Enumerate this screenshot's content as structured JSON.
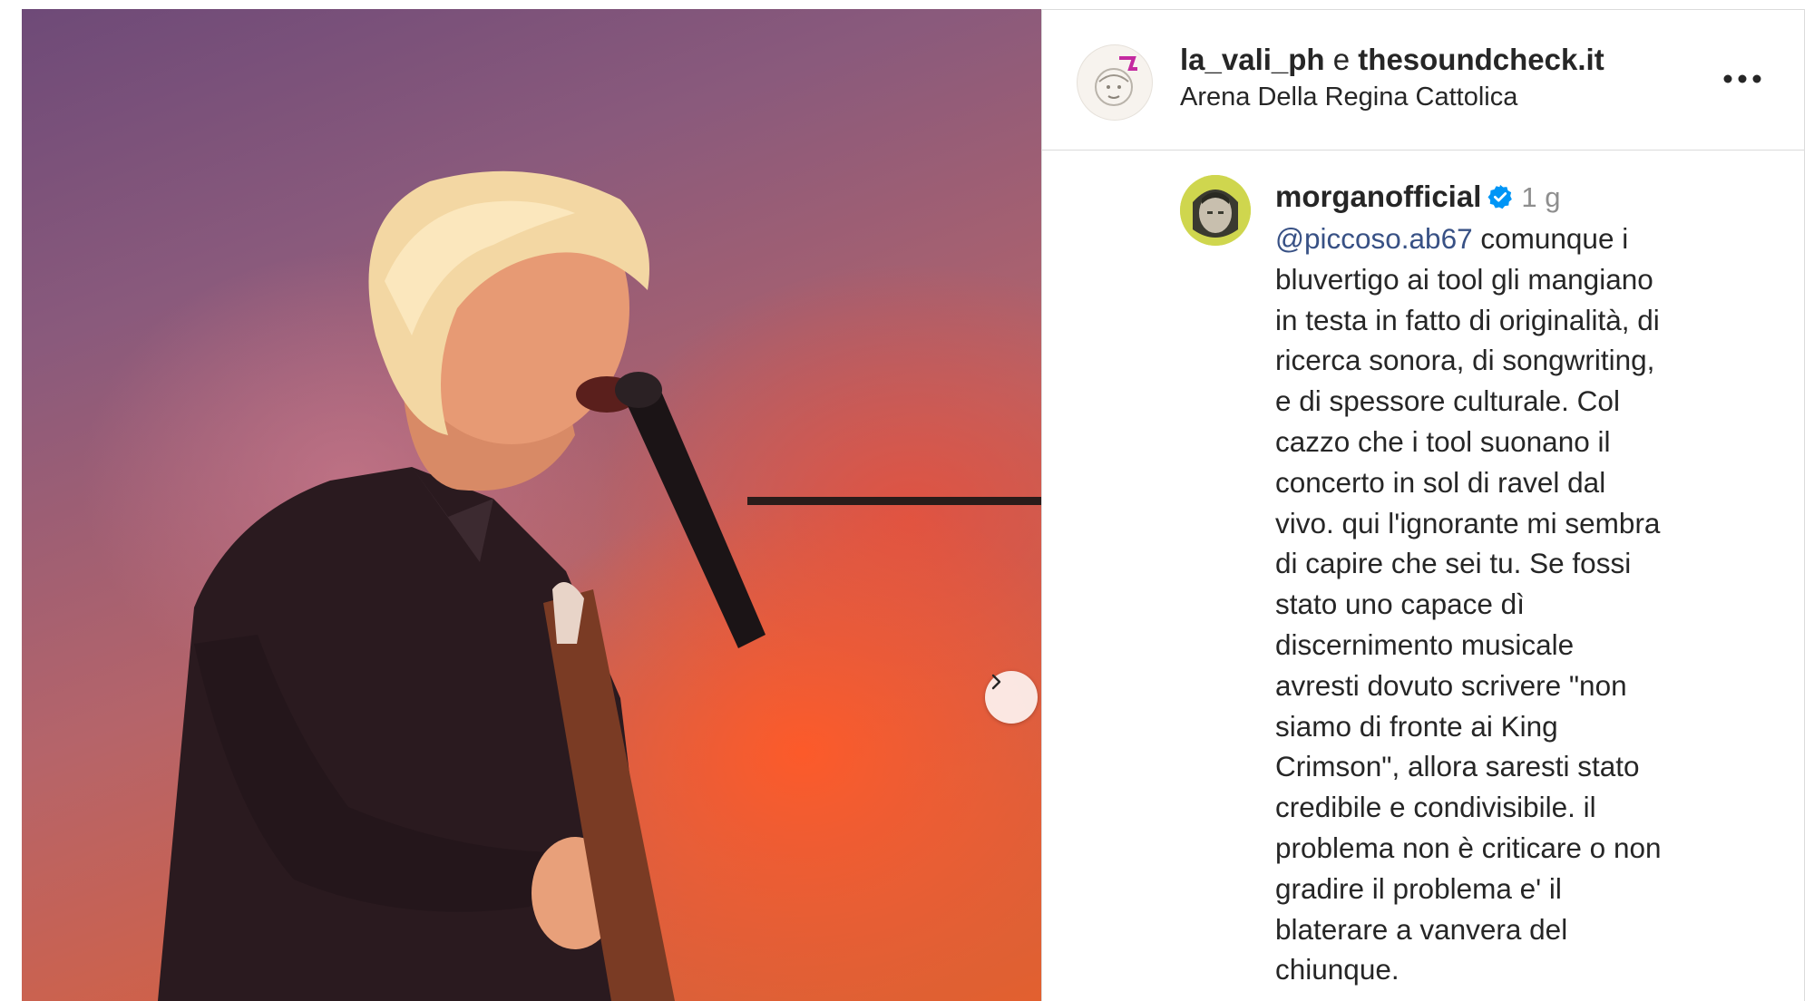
{
  "post": {
    "author_primary": "la_vali_ph",
    "author_joiner": "e",
    "author_secondary": "thesoundcheck.it",
    "location": "Arena Della Regina Cattolica"
  },
  "comment": {
    "username": "morganofficial",
    "time": "1 g",
    "mention": "@piccoso.ab67",
    "text": " comunque i\nbluvertigo ai tool gli mangiano\nin testa in fatto di originalità, di\nricerca sonora, di songwriting,\ne di spessore culturale. Col\ncazzo che i tool suonano il\nconcerto in sol di ravel dal\nvivo. qui l'ignorante mi sembra\ndi capire che sei tu. Se fossi\nstato uno capace dì\ndiscernimento musicale\navresti dovuto scrivere \"non\nsiamo di fronte ai King\nCrimson\", allora saresti stato\ncredibile e condivisibile. il\nproblema non è criticare o non\ngradire il problema e' il\nblaterare a vanvera del\nchiunque."
  },
  "icons": {
    "next": "chevron-right-icon",
    "more": "more-horizontal-icon",
    "like": "heart-outline-icon",
    "verified": "verified-badge-icon"
  },
  "colors": {
    "mention": "#385185",
    "verified": "#0095f6",
    "muted": "#8e8e8e",
    "border": "#dbdbdb"
  }
}
